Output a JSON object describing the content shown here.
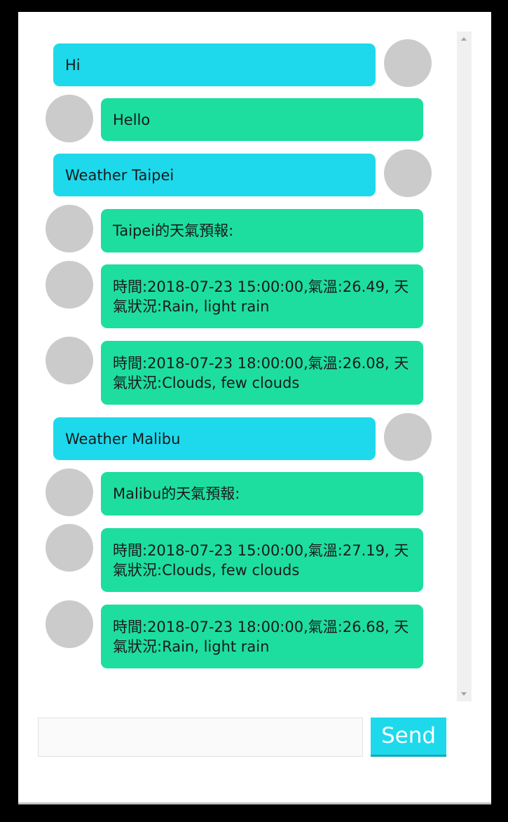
{
  "chat": {
    "messages": [
      {
        "sender": "user",
        "text": "Hi"
      },
      {
        "sender": "bot",
        "text": "Hello"
      },
      {
        "sender": "user",
        "text": "Weather Taipei"
      },
      {
        "sender": "bot",
        "text": "Taipei的天氣預報:"
      },
      {
        "sender": "bot",
        "text": "時間:2018-07-23 15:00:00,氣溫:26.49, 天氣狀況:Rain, light rain"
      },
      {
        "sender": "bot",
        "text": "時間:2018-07-23 18:00:00,氣溫:26.08, 天氣狀況:Clouds, few clouds"
      },
      {
        "sender": "user",
        "text": "Weather Malibu"
      },
      {
        "sender": "bot",
        "text": "Malibu的天氣預報:"
      },
      {
        "sender": "bot",
        "text": "時間:2018-07-23 15:00:00,氣溫:27.19, 天氣狀況:Clouds, few clouds"
      },
      {
        "sender": "bot",
        "text": "時間:2018-07-23 18:00:00,氣溫:26.68, 天氣狀況:Rain, light rain"
      }
    ]
  },
  "composer": {
    "input_value": "",
    "input_placeholder": "",
    "send_label": "Send"
  },
  "colors": {
    "user_bubble": "#1ed9ec",
    "bot_bubble": "#1dde9f",
    "avatar": "#cbcbcb",
    "send_button": "#1ed9ec"
  }
}
